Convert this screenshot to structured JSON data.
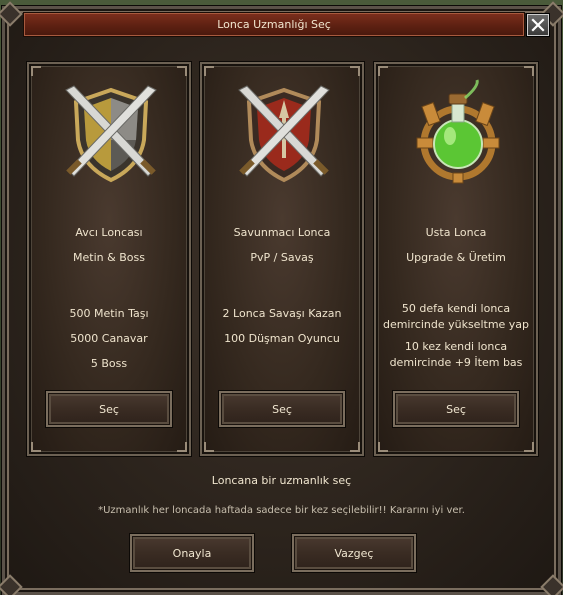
{
  "window": {
    "title": "Lonca Uzmanlığı Seç"
  },
  "guilds": [
    {
      "name": "Avcı Loncası",
      "focus": "Metin & Boss",
      "requirements": [
        "500 Metin Taşı",
        "5000 Canavar",
        "5 Boss"
      ],
      "button": "Seç",
      "icon": "shield-crossed-swords-gold-icon"
    },
    {
      "name": "Savunmacı Lonca",
      "focus": "PvP / Savaş",
      "requirements": [
        "2 Lonca Savaşı Kazan",
        "100 Düşman Oyuncu"
      ],
      "button": "Seç",
      "icon": "shield-crossed-swords-red-icon"
    },
    {
      "name": "Usta Lonca",
      "focus": "Upgrade & Üretim",
      "requirements_lines": [
        "50 defa kendi lonca",
        "demircinde yükseltme yap",
        "10 kez kendi lonca",
        "demircinde +9 İtem bas"
      ],
      "button": "Seç",
      "icon": "potion-flask-icon"
    }
  ],
  "hint": "Loncana bir uzmanlık seç",
  "note": "*Uzmanlık her loncada haftada sadece bir kez seçilebilir!! Kararını iyi ver.",
  "actions": {
    "confirm": "Onayla",
    "cancel": "Vazgeç"
  },
  "colors": {
    "title_bar": "#5e2112",
    "panel_border": "#6c6153",
    "potion": "#6fd43a"
  }
}
